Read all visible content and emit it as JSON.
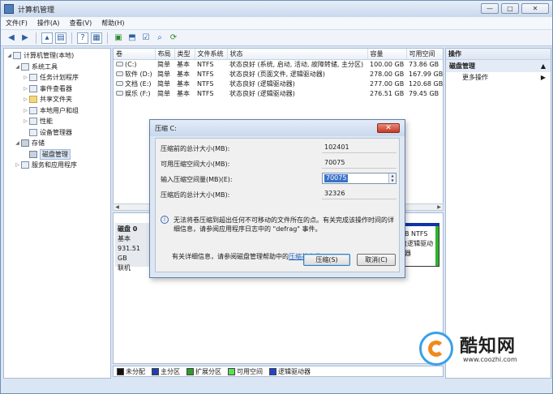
{
  "window": {
    "title": "计算机管理",
    "controls": [
      "—",
      "□",
      "✕"
    ]
  },
  "menu": [
    "文件(F)",
    "操作(A)",
    "查看(V)",
    "帮助(H)"
  ],
  "toolbar_icons": [
    "back-arrow-icon",
    "forward-arrow-icon",
    "up-folder-icon",
    "show-hide-tree-icon",
    "help-icon",
    "properties-icon",
    "export-icon",
    "open-icon",
    "search-icon",
    "settings-icon"
  ],
  "tree": [
    {
      "label": "计算机管理(本地)",
      "level": 0,
      "exp": "◢"
    },
    {
      "label": "系统工具",
      "level": 1,
      "exp": "◢"
    },
    {
      "label": "任务计划程序",
      "level": 2,
      "exp": "▷"
    },
    {
      "label": "事件查看器",
      "level": 2,
      "exp": "▷"
    },
    {
      "label": "共享文件夹",
      "level": 2,
      "exp": "▷"
    },
    {
      "label": "本地用户和组",
      "level": 2,
      "exp": "▷"
    },
    {
      "label": "性能",
      "level": 2,
      "exp": "▷"
    },
    {
      "label": "设备管理器",
      "level": 2,
      "exp": ""
    },
    {
      "label": "存储",
      "level": 1,
      "exp": "◢"
    },
    {
      "label": "磁盘管理",
      "level": 2,
      "exp": "",
      "selected": true
    },
    {
      "label": "服务和应用程序",
      "level": 1,
      "exp": "▷"
    }
  ],
  "volumes": {
    "headers": [
      "卷",
      "布局",
      "类型",
      "文件系统",
      "状态",
      "容量",
      "可用空间"
    ],
    "rows": [
      [
        "(C:)",
        "简单",
        "基本",
        "NTFS",
        "状态良好 (系统, 启动, 活动, 故障转储, 主分区)",
        "100.00 GB",
        "73.86 GB"
      ],
      [
        "软件 (D:)",
        "简单",
        "基本",
        "NTFS",
        "状态良好 (页面文件, 逻辑驱动器)",
        "278.00 GB",
        "167.99 GB"
      ],
      [
        "文档 (E:)",
        "简单",
        "基本",
        "NTFS",
        "状态良好 (逻辑驱动器)",
        "277.00 GB",
        "120.68 GB"
      ],
      [
        "娱乐 (F:)",
        "简单",
        "基本",
        "NTFS",
        "状态良好 (逻辑驱动器)",
        "276.51 GB",
        "79.45 GB"
      ]
    ]
  },
  "disk": {
    "name": "磁盘 0",
    "type": "基本",
    "size": "931.51 GB",
    "status": "联机",
    "partition_fs": "B NTFS",
    "partition_status": "(逻辑驱动器"
  },
  "legend": [
    {
      "label": "未分配",
      "color": "#111111"
    },
    {
      "label": "主分区",
      "color": "#1f3fb0"
    },
    {
      "label": "扩展分区",
      "color": "#2a9d2a"
    },
    {
      "label": "可用空间",
      "color": "#58e058"
    },
    {
      "label": "逻辑驱动器",
      "color": "#2243c9"
    }
  ],
  "actions": {
    "header": "操作",
    "section": "磁盘管理",
    "more": "更多操作"
  },
  "dialog": {
    "title": "压缩 C:",
    "total_before_label": "压缩前的总计大小(MB):",
    "total_before_value": "102401",
    "available_label": "可用压缩空间大小(MB):",
    "available_value": "70075",
    "input_label": "输入压缩空间量(MB)(E):",
    "input_value": "70075",
    "total_after_label": "压缩后的总计大小(MB):",
    "total_after_value": "32326",
    "note": "无法将卷压缩到超出任何不可移动的文件所在的点。有关完成该操作时间的详细信息，请参阅应用程序日志中的 \"defrag\" 事件。",
    "help_prefix": "有关详细信息，请参阅磁盘管理帮助中的",
    "help_link": "压缩基本卷",
    "help_suffix": "。",
    "ok": "压缩(S)",
    "cancel": "取消(C)"
  },
  "watermark": {
    "name": "酷知网",
    "url": "www.coozhi.com"
  }
}
